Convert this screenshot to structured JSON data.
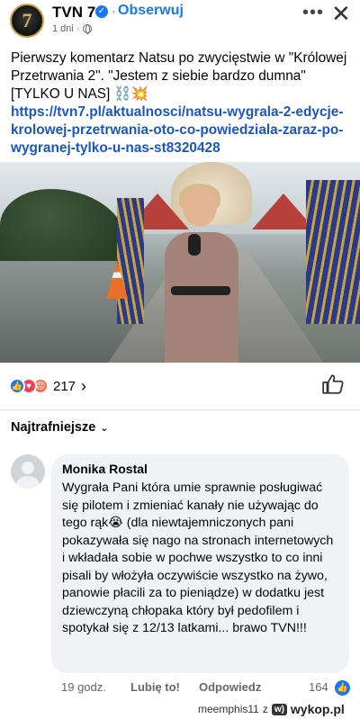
{
  "header": {
    "page_name": "TVN 7",
    "avatar_text": "7",
    "follow_label": "Obserwuj",
    "time": "1 dni",
    "more_label": "•••",
    "close_label": "✕"
  },
  "post": {
    "text": "Pierwszy komentarz Natsu po zwycięstwie w \"Królowej Przetrwania 2\". \"Jestem z siebie bardzo dumna\" [TYLKO U NAS] ⛓️💥",
    "link": "https://tvn7.pl/aktualnosci/natsu-wygrala-2-edycje-krolowej-przetrwania-oto-co-powiedziala-zaraz-po-wygranej-tylko-u-nas-st8320428"
  },
  "reactions": {
    "count": "217",
    "chevron": "›"
  },
  "sort_label": "Najtrafniejsze",
  "comment": {
    "author": "Monika Rostal",
    "text": "Wygrała Pani która umie sprawnie posługiwać się pilotem i zmieniać kanały nie używając do tego rąk😭 (dla niewtajemniczonych pani pokazywała się nago na stronach internetowych i wkładała sobie w pochwe wszystko to co inni pisali by włożyła oczywiście wszystko na żywo, panowie płacili za to pieniądze) w dodatku jest dziewczyną chłopaka który był pedofilem i spotykał się z 12/13 latkami... brawo TVN!!!",
    "time": "19 godz.",
    "like_label": "Lubię to!",
    "reply_label": "Odpowiedz",
    "likes": "164"
  },
  "watermark": {
    "user": "meemphis11",
    "z": "z",
    "logo": "w)",
    "site": "wykop.pl"
  },
  "colors": {
    "accent": "#1877f2",
    "link": "#1a56c6",
    "bubble": "#f0f2f5"
  }
}
